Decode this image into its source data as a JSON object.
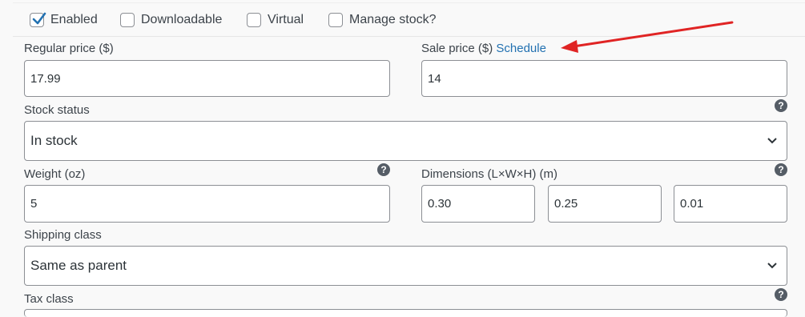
{
  "options": {
    "enabled": {
      "label": "Enabled",
      "checked": true
    },
    "downloadable": {
      "label": "Downloadable",
      "checked": false
    },
    "virtual": {
      "label": "Virtual",
      "checked": false
    },
    "manage_stock": {
      "label": "Manage stock?",
      "checked": false
    }
  },
  "regular_price": {
    "label": "Regular price ($)",
    "value": "17.99"
  },
  "sale_price": {
    "label": "Sale price ($)",
    "schedule_link": "Schedule",
    "value": "14"
  },
  "stock_status": {
    "label": "Stock status",
    "value": "In stock"
  },
  "weight": {
    "label": "Weight (oz)",
    "value": "5"
  },
  "dimensions": {
    "label": "Dimensions (L×W×H) (m)",
    "length": "0.30",
    "width": "0.25",
    "height": "0.01"
  },
  "shipping_class": {
    "label": "Shipping class",
    "value": "Same as parent"
  },
  "tax_class": {
    "label": "Tax class"
  },
  "icons": {
    "help": "help-icon",
    "check": "check-icon",
    "chevron": "chevron-down-icon",
    "arrow": "red-arrow-annotation"
  },
  "colors": {
    "link": "#2271b1",
    "annotation": "#e02424",
    "help_bg": "#555d66"
  }
}
